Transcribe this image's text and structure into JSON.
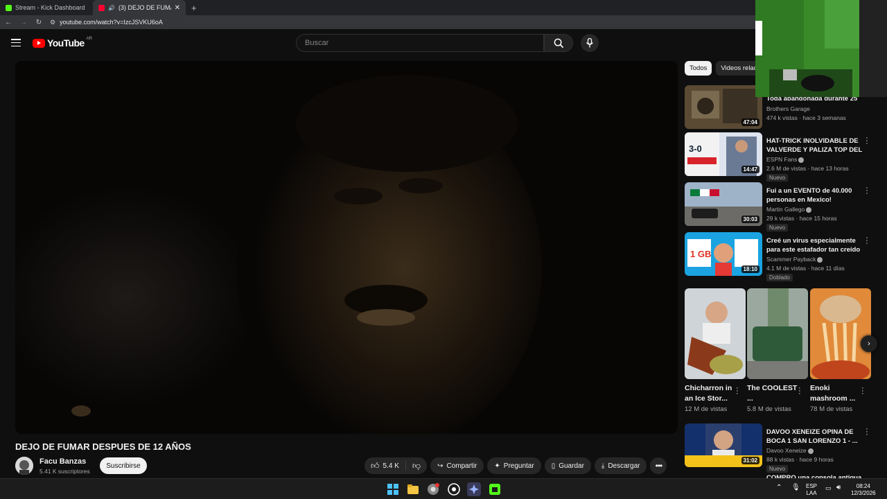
{
  "browser": {
    "tabs": [
      {
        "label": "Stream - Kick Dashboard",
        "color": "#53fc18"
      },
      {
        "label": "(3) DEJO DE FUMAR DESPUES DE 12 AÑOS",
        "color": "#ff0033"
      }
    ],
    "url": "youtube.com/watch?v=IzcJSVKU6oA"
  },
  "header": {
    "logo_text": "YouTube",
    "region": "AR",
    "search_placeholder": "Buscar"
  },
  "video": {
    "title": "DEJO DE FUMAR DESPUES DE 12 AÑOS",
    "channel": "Facu Banzas",
    "subscribers": "5.41 K suscriptores",
    "subscribe_label": "Suscribirse",
    "likes": "5.4 K",
    "share_label": "Compartir",
    "ask_label": "Preguntar",
    "save_label": "Guardar",
    "download_label": "Descargar"
  },
  "sidebar": {
    "chips": [
      "Todos",
      "Videos relacionados"
    ],
    "recs": [
      {
        "title": "Toda abandonada durante 25 ...",
        "channel": "Brothers Garage",
        "verified": false,
        "views": "474 k vistas · hace 3 semanas",
        "duration": "47:04",
        "badge": ""
      },
      {
        "title": "HAT-TRICK INOLVIDABLE DE VALVERDE Y PALIZA TOP DEL ...",
        "channel": "ESPN Fans",
        "verified": true,
        "views": "2.6 M de vistas · hace 13 horas",
        "duration": "14:47",
        "badge": "Nuevo"
      },
      {
        "title": "Fui a un EVENTO de 40.000 personas en Mexico! Japones...",
        "channel": "Martin Gallego",
        "verified": true,
        "views": "29 k vistas · hace 15 horas",
        "duration": "30:03",
        "badge": "Nuevo"
      },
      {
        "title": "Creé un virus especialmente para este estafador tan creído",
        "channel": "Scammer Payback",
        "verified": true,
        "views": "4.1 M de vistas · hace 11 días",
        "duration": "18:10",
        "badge": "Doblado"
      }
    ],
    "shorts": [
      {
        "title": "Chicharron in an Ice Stor...",
        "views": "12 M de vistas"
      },
      {
        "title": "The COOLEST ...",
        "views": "5.8 M de vistas"
      },
      {
        "title": "Enoki mashroom ...",
        "views": "78 M de vistas"
      }
    ],
    "rec_bottom": {
      "title": "DAVOO XENEIZE OPINA DE BOCA 1 SAN LORENZO 1 - ...",
      "channel": "Davoo Xeneize",
      "verified": true,
      "views": "88 k vistas · hace 9 horas",
      "duration": "31:02",
      "badge": "Nuevo"
    },
    "rec_cut": {
      "title": "COMPRO una consola antigua ..."
    }
  },
  "taskbar": {
    "lang_top": "ESP",
    "lang_bottom": "LAA",
    "time": "08:24",
    "date": "12/3/2026"
  }
}
